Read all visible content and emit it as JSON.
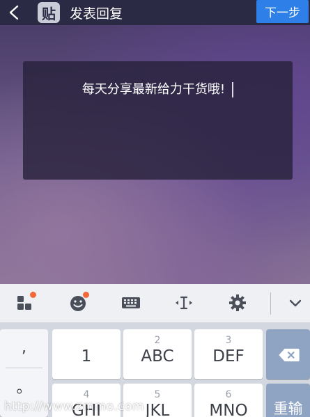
{
  "header": {
    "back_icon": "chevron-left-icon",
    "logo_text": "贴",
    "title": "发表回复",
    "next_label": "下一步"
  },
  "card": {
    "text": "每天分享最新给力干货哦!"
  },
  "keyboard_toolbar": {
    "icons": [
      "apps-grid-icon",
      "emoji-icon",
      "keyboard-icon",
      "cursor-move-icon",
      "gear-icon",
      "chevron-down-icon"
    ],
    "badge_color": "#f26a3a"
  },
  "keyboard": {
    "punct_top": ",",
    "punct_bottom": "。",
    "row1": [
      {
        "num": "",
        "main": "1"
      },
      {
        "num": "2",
        "main": "ABC"
      },
      {
        "num": "3",
        "main": "DEF"
      }
    ],
    "row2": [
      {
        "num": "4",
        "main": "GHI"
      },
      {
        "num": "5",
        "main": "JKL"
      },
      {
        "num": "6",
        "main": "MNO"
      }
    ],
    "backspace_icon": "backspace-icon",
    "retype_label": "重输"
  },
  "watermark": "http://www.zmmo.com",
  "colors": {
    "topbar": "#2b2a45",
    "accent": "#2e7fe8"
  }
}
